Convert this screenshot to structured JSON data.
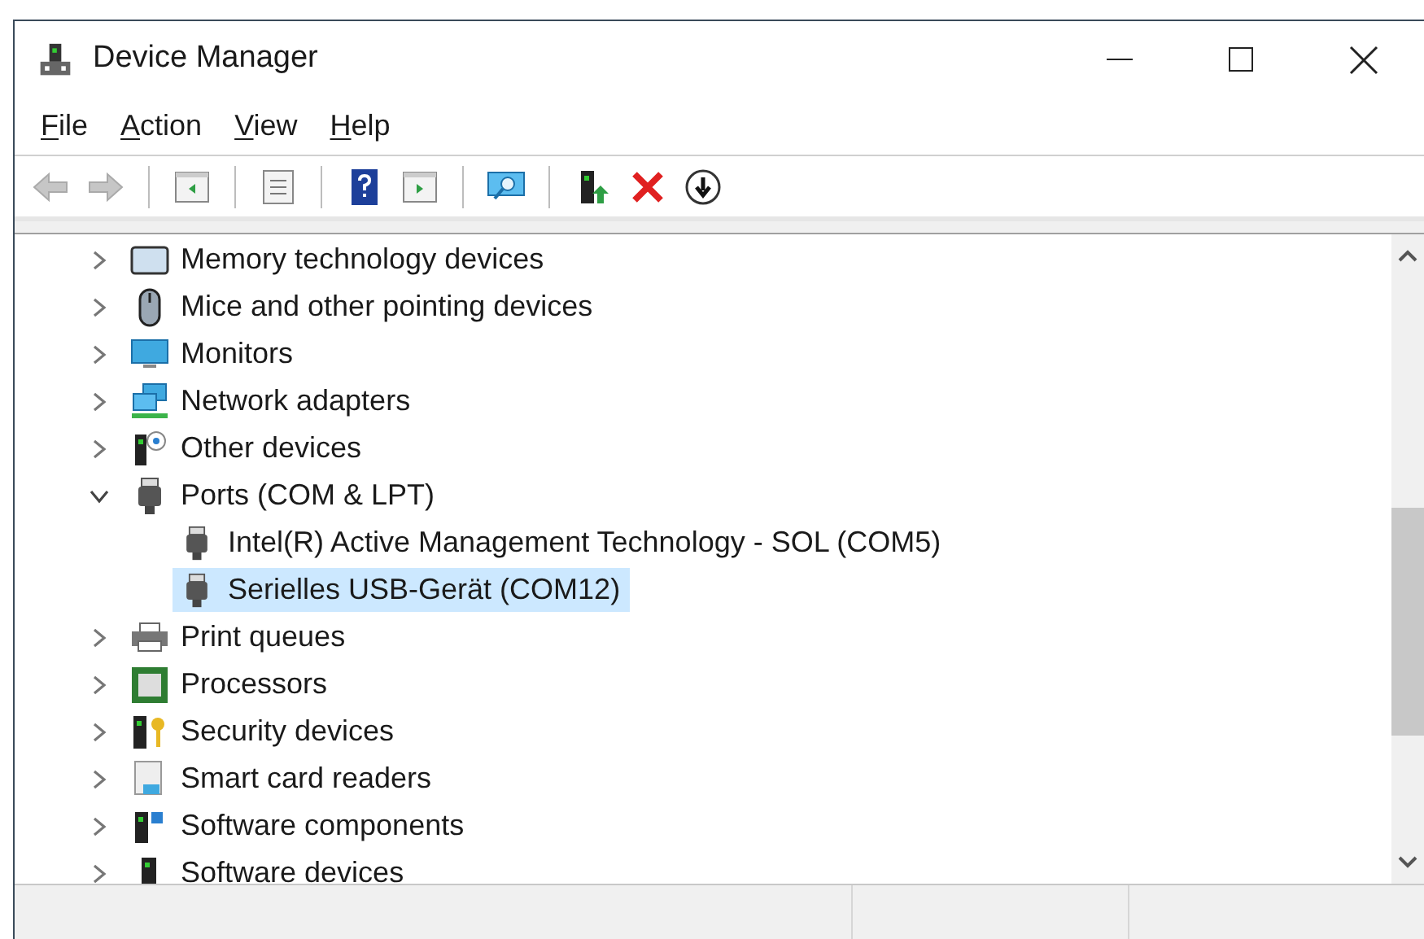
{
  "window": {
    "title": "Device Manager"
  },
  "menu": [
    {
      "label": "File"
    },
    {
      "label": "Action"
    },
    {
      "label": "View"
    },
    {
      "label": "Help"
    }
  ],
  "toolbar": [
    {
      "kind": "back",
      "disabled": true
    },
    {
      "kind": "forward",
      "disabled": true
    },
    {
      "kind": "separator"
    },
    {
      "kind": "console-tree"
    },
    {
      "kind": "separator"
    },
    {
      "kind": "properties"
    },
    {
      "kind": "separator"
    },
    {
      "kind": "help"
    },
    {
      "kind": "action-pane"
    },
    {
      "kind": "separator"
    },
    {
      "kind": "scan"
    },
    {
      "kind": "separator"
    },
    {
      "kind": "update-driver"
    },
    {
      "kind": "uninstall"
    },
    {
      "kind": "disable"
    }
  ],
  "tree": [
    {
      "label": "Memory technology devices",
      "expanded": false
    },
    {
      "label": "Mice and other pointing devices",
      "expanded": false
    },
    {
      "label": "Monitors",
      "expanded": false
    },
    {
      "label": "Network adapters",
      "expanded": false
    },
    {
      "label": "Other devices",
      "expanded": false
    },
    {
      "label": "Ports (COM & LPT)",
      "expanded": true,
      "children": [
        {
          "label": "Intel(R) Active Management Technology - SOL (COM5)",
          "selected": false
        },
        {
          "label": "Serielles USB-Gerät (COM12)",
          "selected": true
        }
      ]
    },
    {
      "label": "Print queues",
      "expanded": false
    },
    {
      "label": "Processors",
      "expanded": false
    },
    {
      "label": "Security devices",
      "expanded": false
    },
    {
      "label": "Smart card readers",
      "expanded": false
    },
    {
      "label": "Software components",
      "expanded": false
    },
    {
      "label": "Software devices",
      "expanded": false
    }
  ]
}
